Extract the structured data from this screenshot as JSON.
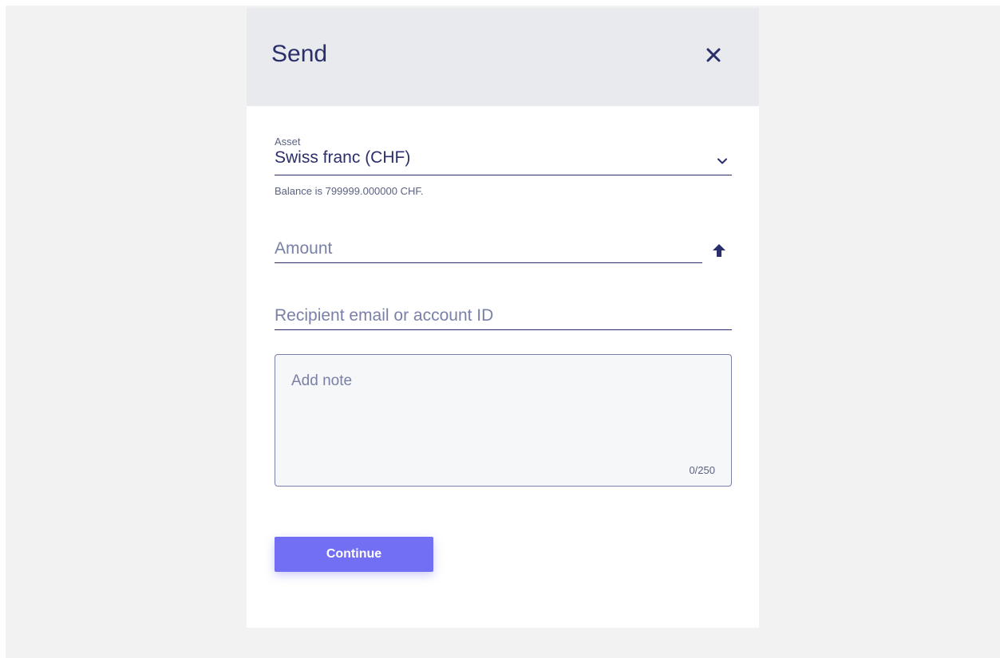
{
  "modal": {
    "title": "Send",
    "close_icon": "close-icon"
  },
  "asset": {
    "label": "Asset",
    "value": "Swiss franc (CHF)",
    "icon": "chevron-down-icon"
  },
  "balance_text": "Balance is 799999.000000 CHF.",
  "amount": {
    "placeholder": "Amount",
    "value": "",
    "max_icon": "arrow-up-icon"
  },
  "recipient": {
    "placeholder": "Recipient email or account ID",
    "value": ""
  },
  "note": {
    "placeholder": "Add note",
    "value": "",
    "counter": "0/250"
  },
  "actions": {
    "continue_label": "Continue"
  },
  "colors": {
    "accent": "#736ff4",
    "text_primary": "#2a2f6b",
    "text_muted": "#7a80a6",
    "header_bg": "#e9eaed",
    "page_bg": "#f2f2f3"
  }
}
